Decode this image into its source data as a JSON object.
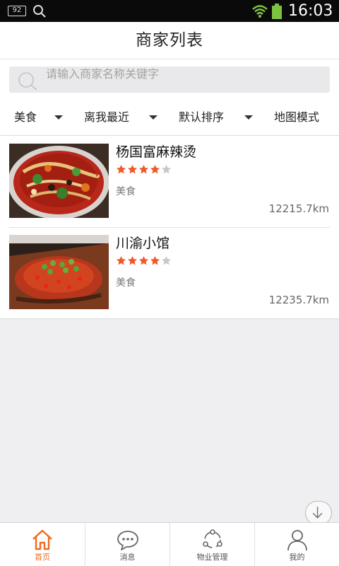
{
  "status_bar": {
    "notification_badge": "92",
    "time": "16:03"
  },
  "header": {
    "title": "商家列表"
  },
  "search": {
    "placeholder": "请输入商家名称关键字"
  },
  "filters": [
    {
      "label": "美食"
    },
    {
      "label": "离我最近"
    },
    {
      "label": "默认排序"
    },
    {
      "label": "地图模式"
    }
  ],
  "merchants": [
    {
      "name": "杨国富麻辣烫",
      "rating": 4,
      "max_rating": 5,
      "category": "美食",
      "distance": "12215.7km"
    },
    {
      "name": "川渝小馆",
      "rating": 4,
      "max_rating": 5,
      "category": "美食",
      "distance": "12235.7km"
    }
  ],
  "tabs": [
    {
      "label": "首页",
      "icon": "home-icon",
      "active": true
    },
    {
      "label": "消息",
      "icon": "message-icon",
      "active": false
    },
    {
      "label": "物业管理",
      "icon": "share-icon",
      "active": false
    },
    {
      "label": "我的",
      "icon": "user-icon",
      "active": false
    }
  ],
  "colors": {
    "accent": "#f06a1f",
    "star_filled": "#f05a28",
    "star_empty": "#c8c8c8"
  }
}
